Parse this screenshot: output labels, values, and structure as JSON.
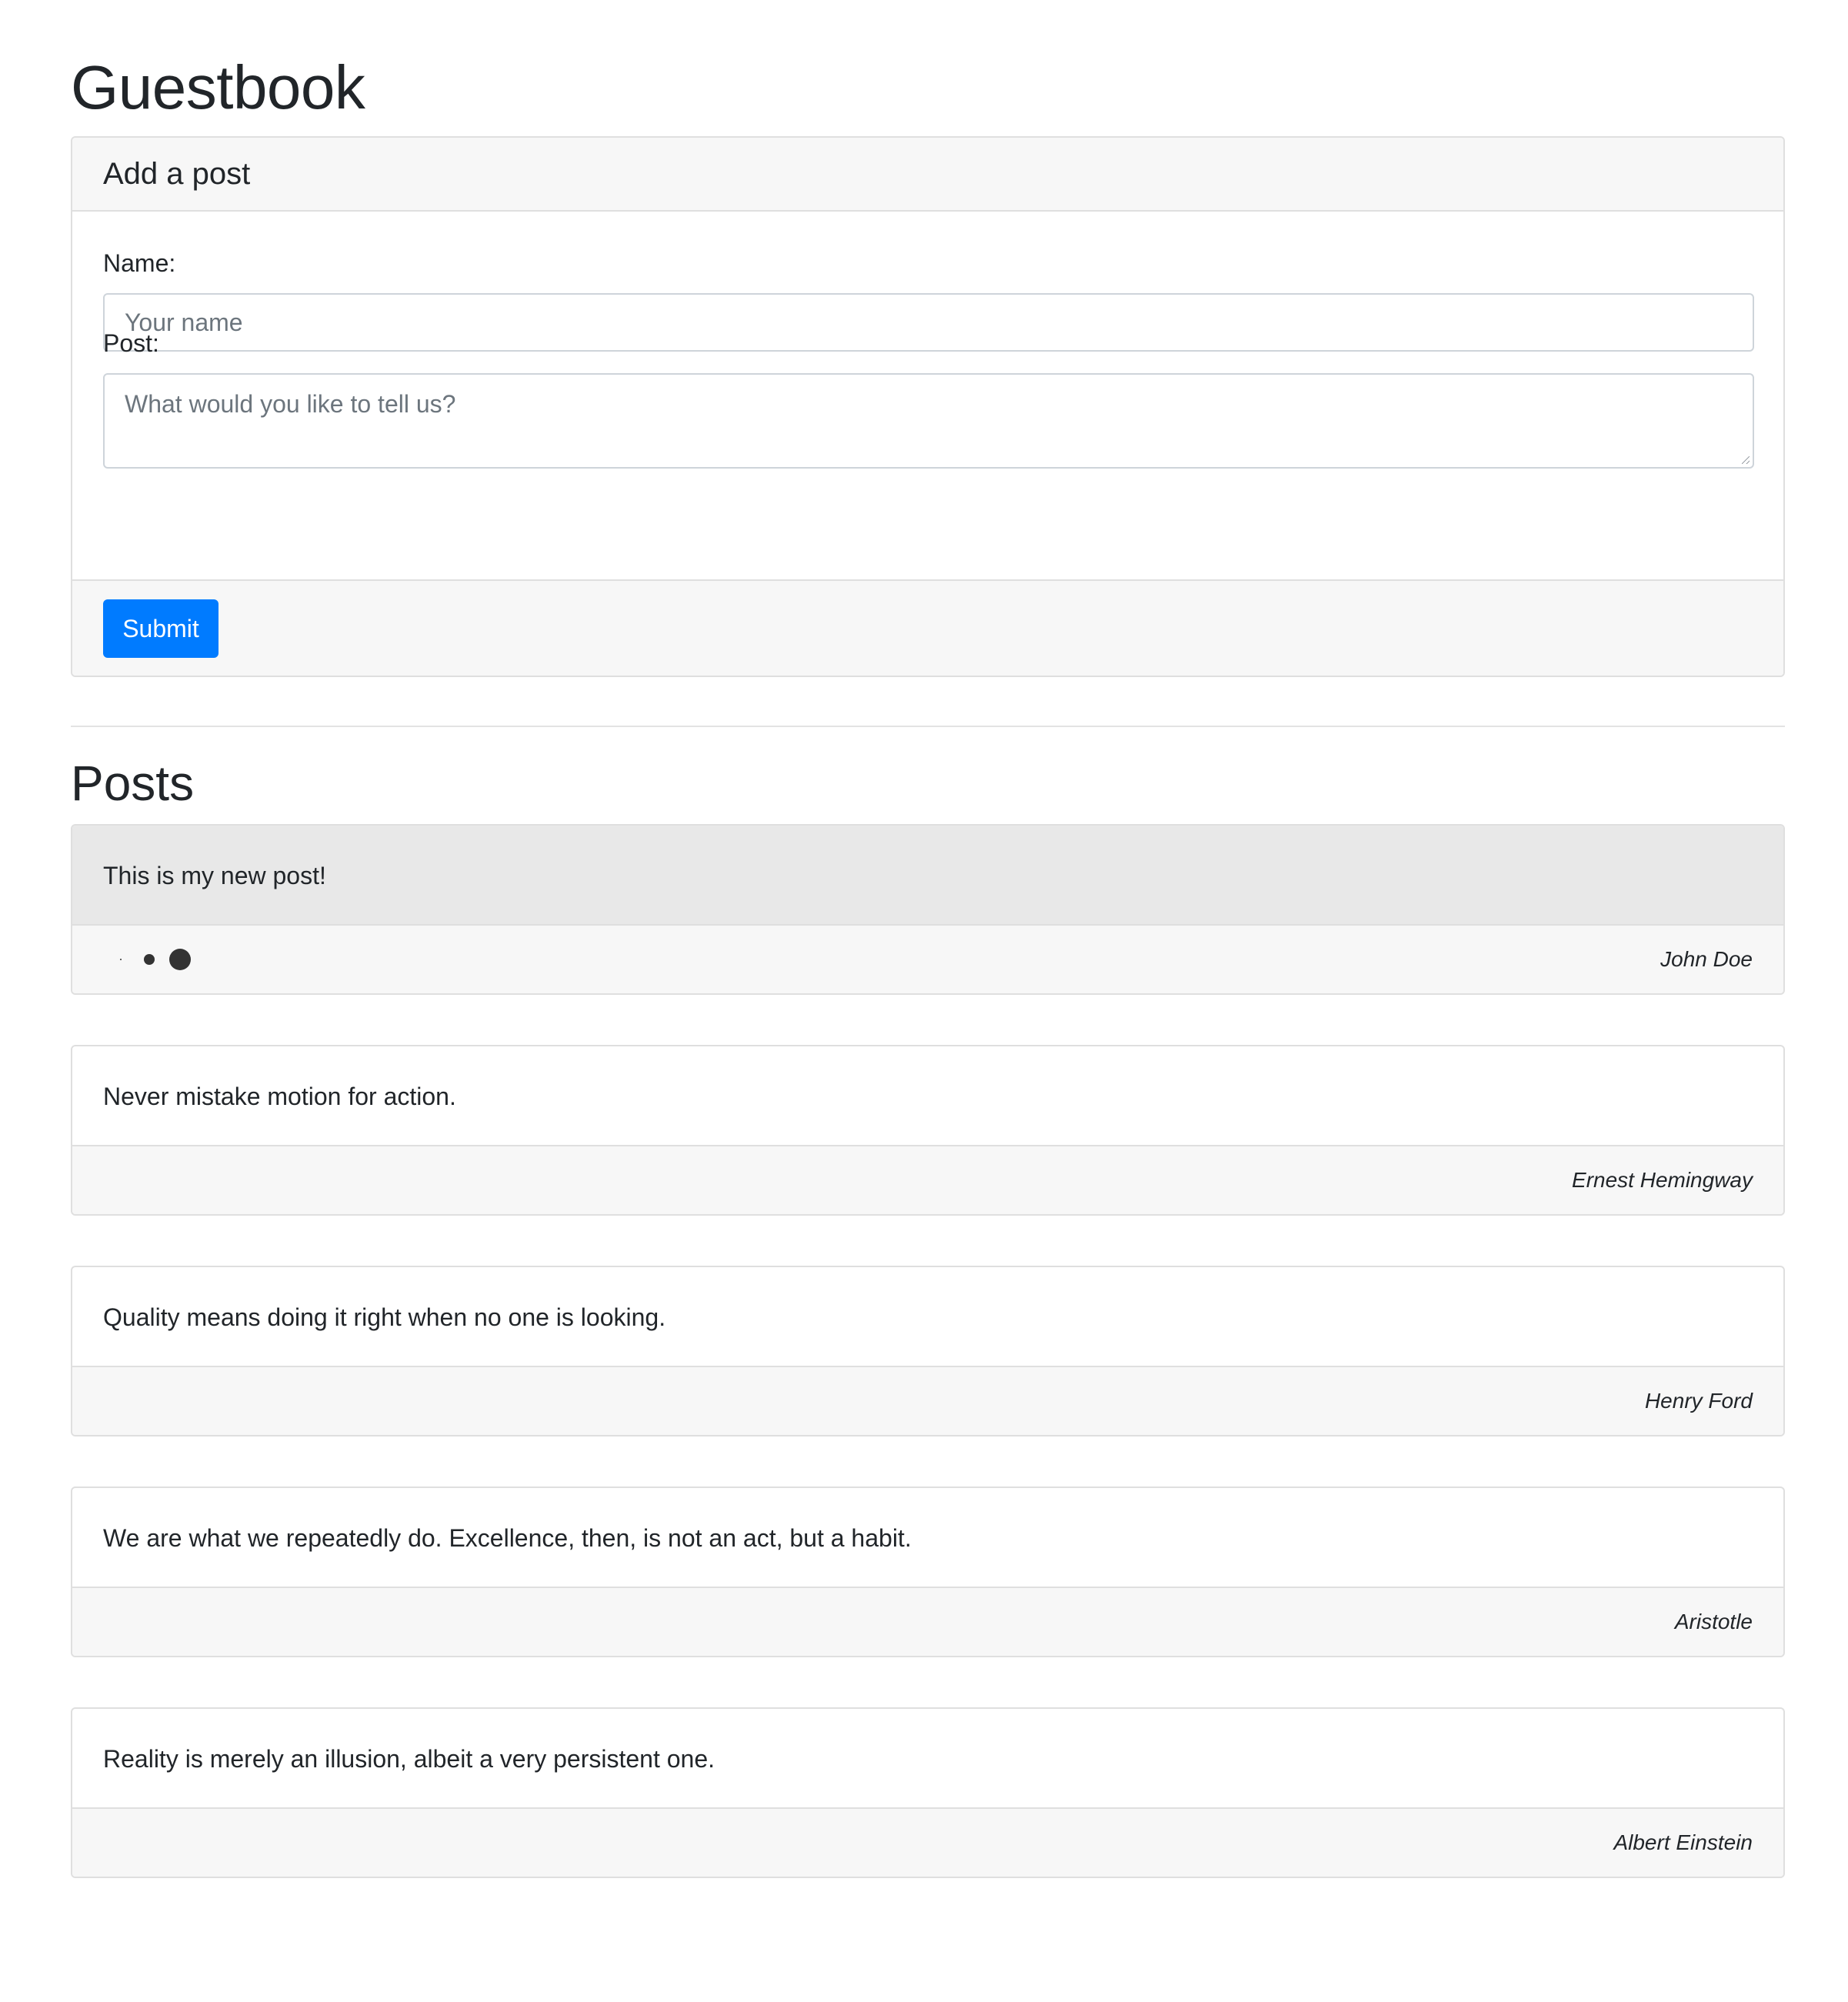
{
  "page": {
    "title": "Guestbook"
  },
  "form": {
    "header": "Add a post",
    "name_label": "Name:",
    "name_placeholder": "Your name",
    "post_label": "Post:",
    "post_placeholder": "What would you like to tell us?",
    "submit_label": "Submit",
    "submit_color": "#007bff"
  },
  "posts_section": {
    "title": "Posts",
    "items": [
      {
        "text": "This is my new post!",
        "author": "John Doe",
        "highlighted": true,
        "loading": true
      },
      {
        "text": "Never mistake motion for action.",
        "author": "Ernest Hemingway"
      },
      {
        "text": "Quality means doing it right when no one is looking.",
        "author": "Henry Ford"
      },
      {
        "text": "We are what we repeatedly do. Excellence, then, is not an act, but a habit.",
        "author": "Aristotle"
      },
      {
        "text": "Reality is merely an illusion, albeit a very persistent one.",
        "author": "Albert Einstein"
      }
    ]
  }
}
